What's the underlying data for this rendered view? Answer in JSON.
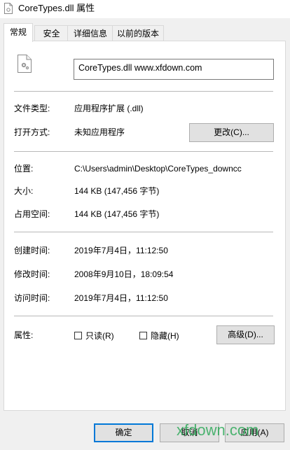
{
  "window": {
    "title": "CoreTypes.dll 属性"
  },
  "tabs": [
    {
      "label": "常规"
    },
    {
      "label": "安全"
    },
    {
      "label": "详细信息"
    },
    {
      "label": "以前的版本"
    }
  ],
  "general": {
    "filename": "CoreTypes.dll  www.xfdown.com",
    "file_type_label": "文件类型:",
    "file_type_value": "应用程序扩展 (.dll)",
    "opens_with_label": "打开方式:",
    "opens_with_value": "未知应用程序",
    "change_button": "更改(C)...",
    "location_label": "位置:",
    "location_value": "C:\\Users\\admin\\Desktop\\CoreTypes_downcc",
    "size_label": "大小:",
    "size_value": "144 KB (147,456 字节)",
    "size_on_disk_label": "占用空间:",
    "size_on_disk_value": "144 KB (147,456 字节)",
    "created_label": "创建时间:",
    "created_value": "2019年7月4日，11:12:50",
    "modified_label": "修改时间:",
    "modified_value": "2008年9月10日，18:09:54",
    "accessed_label": "访问时间:",
    "accessed_value": "2019年7月4日，11:12:50",
    "attributes_label": "属性:",
    "readonly_label": "只读(R)",
    "hidden_label": "隐藏(H)",
    "advanced_button": "高级(D)..."
  },
  "footer": {
    "ok_button": "确定",
    "cancel_button": "取消",
    "apply_button": "应用(A)"
  },
  "watermark": "xfdown.com"
}
